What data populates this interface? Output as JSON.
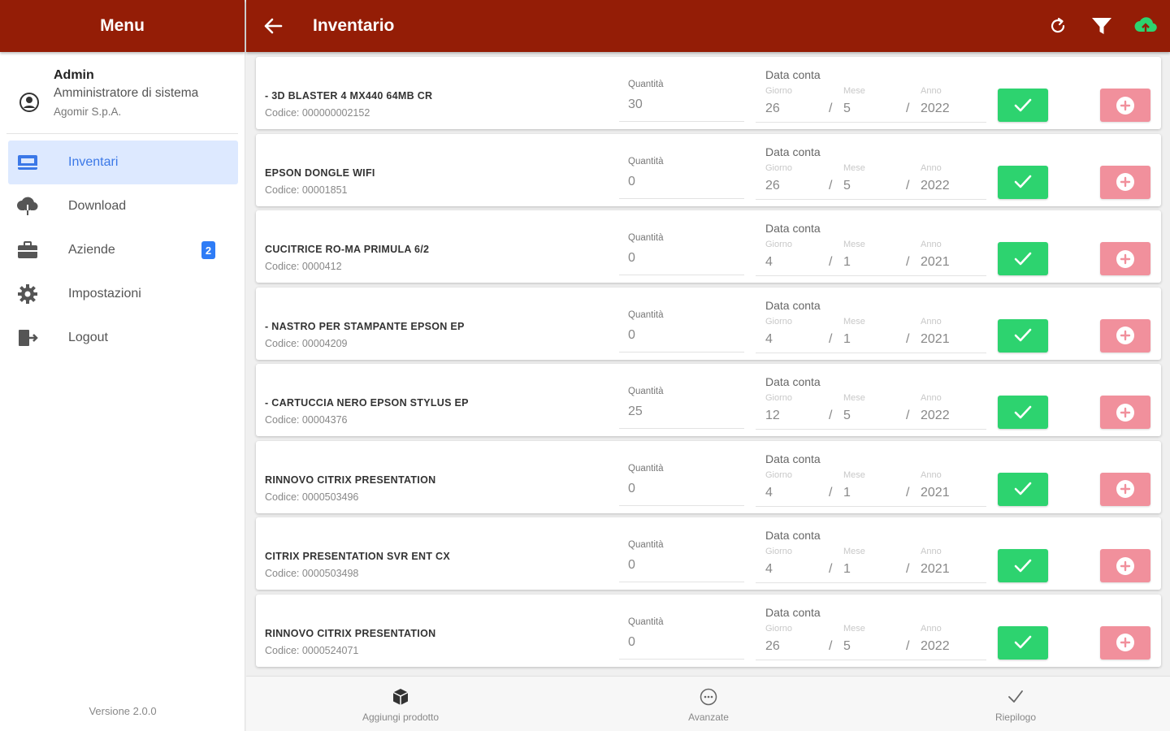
{
  "sidebar": {
    "title": "Menu",
    "profile": {
      "name": "Admin",
      "role": "Amministratore di sistema",
      "company": "Agomir S.p.A."
    },
    "items": [
      {
        "label": "Inventari",
        "icon": "inventory-icon",
        "active": true
      },
      {
        "label": "Download",
        "icon": "cloud-download-icon"
      },
      {
        "label": "Aziende",
        "icon": "briefcase-icon",
        "badge": "2"
      },
      {
        "label": "Impostazioni",
        "icon": "gear-icon"
      },
      {
        "label": "Logout",
        "icon": "logout-icon"
      }
    ],
    "version": "Versione 2.0.0"
  },
  "topbar": {
    "title": "Inventario",
    "actions": [
      "refresh-icon",
      "filter-icon",
      "cloud-upload-icon"
    ]
  },
  "labels": {
    "quantity": "Quantità",
    "date": "Data conta",
    "day": "Giorno",
    "month": "Mese",
    "year": "Anno",
    "separator": "/"
  },
  "products": [
    {
      "name": "- 3D BLASTER 4 MX440 64MB CR",
      "code": "Codice: 000000002152",
      "quantity": "30",
      "day": "26",
      "month": "5",
      "year": "2022"
    },
    {
      "name": "EPSON DONGLE WIFI",
      "code": "Codice: 00001851",
      "quantity": "0",
      "day": "26",
      "month": "5",
      "year": "2022"
    },
    {
      "name": "CUCITRICE RO-MA PRIMULA 6/2",
      "code": "Codice: 0000412",
      "quantity": "0",
      "day": "4",
      "month": "1",
      "year": "2021"
    },
    {
      "name": "- NASTRO PER STAMPANTE EPSON EP",
      "code": "Codice: 00004209",
      "quantity": "0",
      "day": "4",
      "month": "1",
      "year": "2021"
    },
    {
      "name": "- CARTUCCIA NERO EPSON STYLUS EP",
      "code": "Codice: 00004376",
      "quantity": "25",
      "day": "12",
      "month": "5",
      "year": "2022"
    },
    {
      "name": "RINNOVO CITRIX PRESENTATION",
      "code": "Codice: 0000503496",
      "quantity": "0",
      "day": "4",
      "month": "1",
      "year": "2021"
    },
    {
      "name": "CITRIX PRESENTATION SVR ENT CX",
      "code": "Codice: 0000503498",
      "quantity": "0",
      "day": "4",
      "month": "1",
      "year": "2021"
    },
    {
      "name": "RINNOVO CITRIX PRESENTATION",
      "code": "Codice: 0000524071",
      "quantity": "0",
      "day": "26",
      "month": "5",
      "year": "2022"
    }
  ],
  "bottombar": {
    "tabs": [
      {
        "label": "Aggiungi prodotto",
        "icon": "cube-icon"
      },
      {
        "label": "Avanzate",
        "icon": "more-circle-icon"
      },
      {
        "label": "Riepilogo",
        "icon": "checkmark-icon"
      }
    ]
  },
  "colors": {
    "header": "#941d06",
    "accent": "#3b78e7",
    "confirm": "#2dd36f",
    "add": "#f1909c",
    "badge": "#2e7cf6"
  }
}
